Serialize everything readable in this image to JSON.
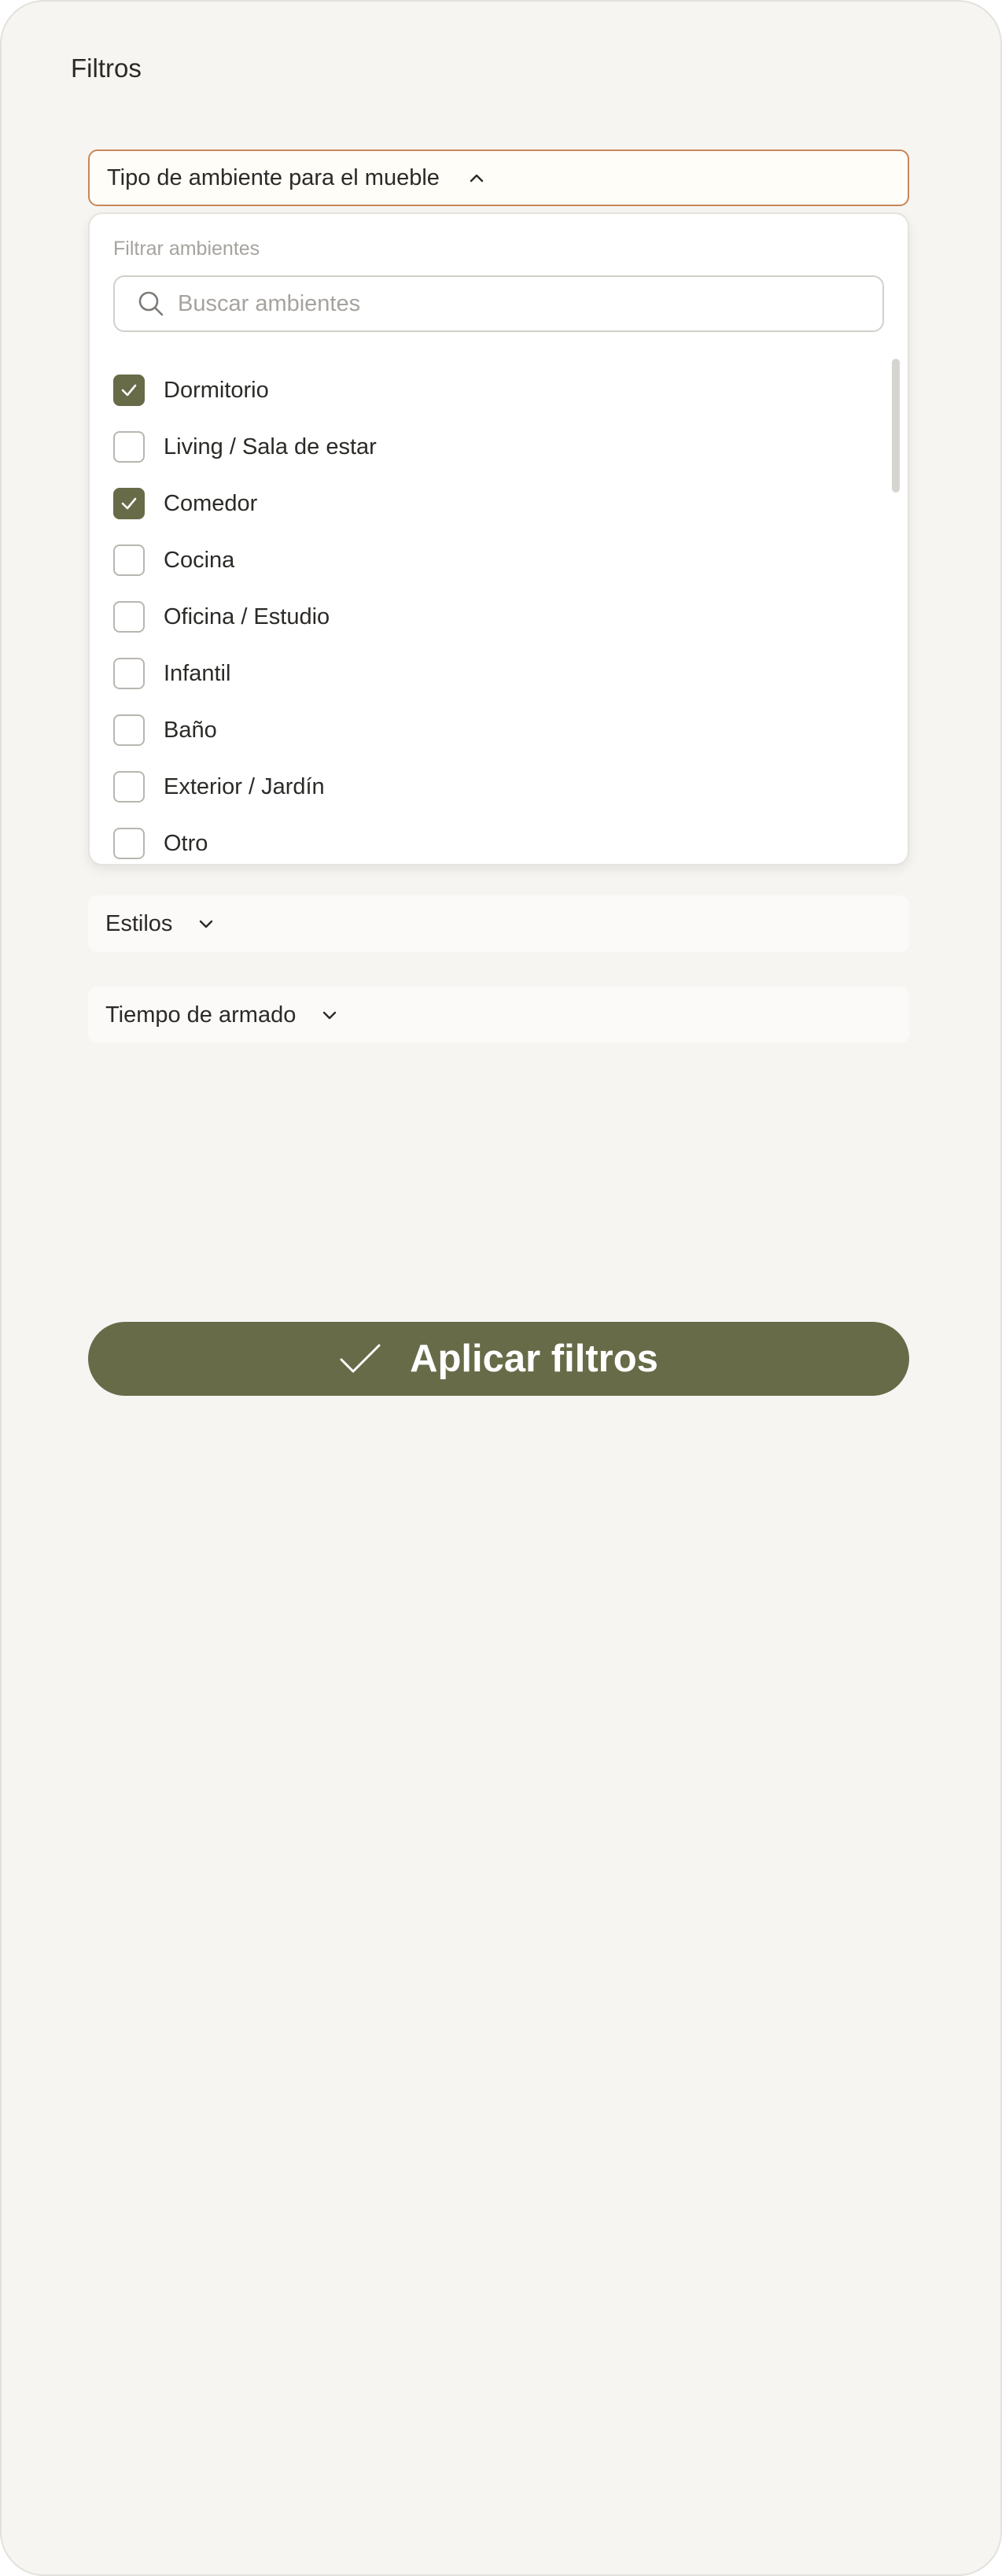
{
  "page": {
    "title": "Filtros"
  },
  "room_filter": {
    "header_label": "Tipo de ambiente para el mueble",
    "panel_label": "Filtrar ambientes",
    "search_placeholder": "Buscar ambientes",
    "search_value": "",
    "options": [
      {
        "label": "Dormitorio",
        "checked": true
      },
      {
        "label": "Living / Sala de estar",
        "checked": false
      },
      {
        "label": "Comedor",
        "checked": true
      },
      {
        "label": "Cocina",
        "checked": false
      },
      {
        "label": "Oficina / Estudio",
        "checked": false
      },
      {
        "label": "Infantil",
        "checked": false
      },
      {
        "label": "Baño",
        "checked": false
      },
      {
        "label": "Exterior / Jardín",
        "checked": false
      },
      {
        "label": "Otro",
        "checked": false
      }
    ]
  },
  "styles_filter": {
    "label": "Estilos"
  },
  "assembly_filter": {
    "label": "Tiempo de armado"
  },
  "apply_button": {
    "label": "Aplicar filtros"
  },
  "icons": {
    "header_chevron": "chevron-up-icon",
    "collapsed_chevron": "chevron-down-icon",
    "search": "search-icon",
    "check": "check-icon"
  },
  "colors": {
    "accent": "#676b48",
    "active_border": "#c9865a",
    "background": "#f6f5f2"
  }
}
